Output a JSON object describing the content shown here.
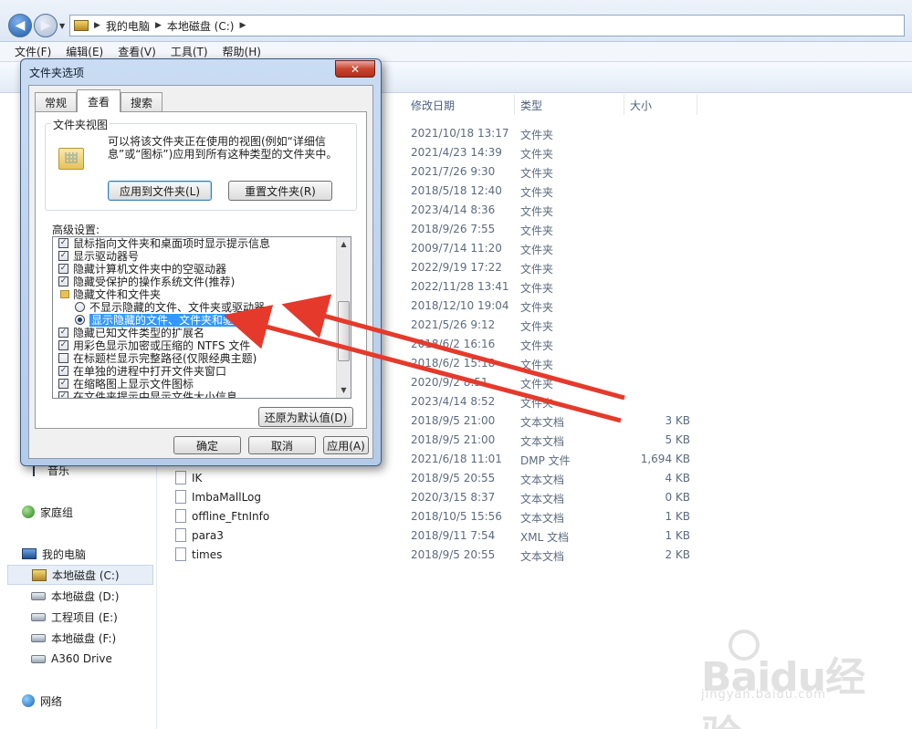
{
  "explorer": {
    "breadcrumb": [
      "我的电脑",
      "本地磁盘 (C:)"
    ],
    "menu": [
      "文件(F)",
      "编辑(E)",
      "查看(V)",
      "工具(T)",
      "帮助(H)"
    ],
    "columns": {
      "date": "修改日期",
      "type": "类型",
      "size": "大小"
    },
    "rows": [
      {
        "name": "",
        "date": "2021/10/18 13:17",
        "type": "文件夹",
        "size": ""
      },
      {
        "name": "",
        "date": "2021/4/23 14:39",
        "type": "文件夹",
        "size": ""
      },
      {
        "name": "",
        "date": "2021/7/26 9:30",
        "type": "文件夹",
        "size": ""
      },
      {
        "name": "",
        "date": "2018/5/18 12:40",
        "type": "文件夹",
        "size": ""
      },
      {
        "name": "",
        "date": "2023/4/14 8:36",
        "type": "文件夹",
        "size": ""
      },
      {
        "name": "",
        "date": "2018/9/26 7:55",
        "type": "文件夹",
        "size": ""
      },
      {
        "name": "",
        "date": "2009/7/14 11:20",
        "type": "文件夹",
        "size": ""
      },
      {
        "name": "",
        "date": "2022/9/19 17:22",
        "type": "文件夹",
        "size": ""
      },
      {
        "name": "",
        "date": "2022/11/28 13:41",
        "type": "文件夹",
        "size": ""
      },
      {
        "name": "",
        "date": "2018/12/10 19:04",
        "type": "文件夹",
        "size": ""
      },
      {
        "name": "",
        "date": "2021/5/26 9:12",
        "type": "文件夹",
        "size": ""
      },
      {
        "name": "",
        "date": "2018/6/2 16:16",
        "type": "文件夹",
        "size": ""
      },
      {
        "name": "",
        "date": "2018/6/2 15:18",
        "type": "文件夹",
        "size": ""
      },
      {
        "name": "",
        "date": "2020/9/2 8:51",
        "type": "文件夹",
        "size": ""
      },
      {
        "name": "",
        "date": "2023/4/14 8:52",
        "type": "文件夹",
        "size": ""
      },
      {
        "name": "",
        "date": "2018/9/5 21:00",
        "type": "文本文档",
        "size": "3 KB"
      },
      {
        "name": "",
        "date": "2018/9/5 21:00",
        "type": "文本文档",
        "size": "5 KB"
      },
      {
        "name": "",
        "date": "2021/6/18 11:01",
        "type": "DMP 文件",
        "size": "1,694 KB"
      },
      {
        "name": "IK",
        "date": "2018/9/5 20:55",
        "type": "文本文档",
        "size": "4 KB"
      },
      {
        "name": "ImbaMallLog",
        "date": "2020/3/15 8:37",
        "type": "文本文档",
        "size": "0 KB"
      },
      {
        "name": "offline_FtnInfo",
        "date": "2018/10/5 15:56",
        "type": "文本文档",
        "size": "1 KB"
      },
      {
        "name": "para3",
        "date": "2018/9/11 7:54",
        "type": "XML 文档",
        "size": "1 KB"
      },
      {
        "name": "times",
        "date": "2018/9/5 20:55",
        "type": "文本文档",
        "size": "2 KB"
      }
    ],
    "tree": [
      {
        "label": "音乐",
        "icon": "music-icon",
        "selected": false
      },
      {
        "label": "家庭组",
        "icon": "homegroup-icon",
        "selected": false
      },
      {
        "label": "我的电脑",
        "icon": "computer-icon",
        "selected": false
      },
      {
        "label": "本地磁盘 (C:)",
        "icon": "system-drive-icon",
        "selected": true
      },
      {
        "label": "本地磁盘 (D:)",
        "icon": "drive-icon",
        "selected": false
      },
      {
        "label": "工程项目 (E:)",
        "icon": "drive-icon",
        "selected": false
      },
      {
        "label": "本地磁盘 (F:)",
        "icon": "drive-icon",
        "selected": false
      },
      {
        "label": "A360 Drive",
        "icon": "cloud-drive-icon",
        "selected": false
      },
      {
        "label": "网络",
        "icon": "network-icon",
        "selected": false
      }
    ]
  },
  "dialog": {
    "title": "文件夹选项",
    "close_label": "✕",
    "tabs": [
      "常规",
      "查看",
      "搜索"
    ],
    "active_tab": "查看",
    "folder_views": {
      "title": "文件夹视图",
      "description": "可以将该文件夹正在使用的视图(例如“详细信息”或“图标”)应用到所有这种类型的文件夹中。",
      "apply_button": "应用到文件夹(L)",
      "reset_button": "重置文件夹(R)"
    },
    "advanced_label": "高级设置:",
    "settings": [
      {
        "kind": "checkbox",
        "checked": true,
        "label": "鼠标指向文件夹和桌面项时显示提示信息"
      },
      {
        "kind": "checkbox",
        "checked": true,
        "label": "显示驱动器号"
      },
      {
        "kind": "checkbox",
        "checked": true,
        "label": "隐藏计算机文件夹中的空驱动器"
      },
      {
        "kind": "checkbox",
        "checked": true,
        "label": "隐藏受保护的操作系统文件(推荐)"
      },
      {
        "kind": "folder",
        "label": "隐藏文件和文件夹"
      },
      {
        "kind": "radio",
        "checked": false,
        "label": "不显示隐藏的文件、文件夹或驱动器"
      },
      {
        "kind": "radio",
        "checked": true,
        "selected": true,
        "label": "显示隐藏的文件、文件夹和驱动器"
      },
      {
        "kind": "checkbox",
        "checked": true,
        "label": "隐藏已知文件类型的扩展名"
      },
      {
        "kind": "checkbox",
        "checked": true,
        "label": "用彩色显示加密或压缩的 NTFS 文件"
      },
      {
        "kind": "checkbox",
        "checked": false,
        "label": "在标题栏显示完整路径(仅限经典主题)"
      },
      {
        "kind": "checkbox",
        "checked": true,
        "label": "在单独的进程中打开文件夹窗口"
      },
      {
        "kind": "checkbox",
        "checked": true,
        "label": "在缩略图上显示文件图标"
      },
      {
        "kind": "checkbox",
        "checked": true,
        "label": "在文件夹提示中显示文件大小信息"
      }
    ],
    "restore_defaults": "还原为默认值(D)",
    "ok": "确定",
    "cancel": "取消",
    "apply": "应用(A)"
  },
  "annotation": {
    "arrow_color": "#e53a2b"
  },
  "watermark": {
    "brand": "Baidu经验",
    "url": "jingyan.baidu.com"
  }
}
